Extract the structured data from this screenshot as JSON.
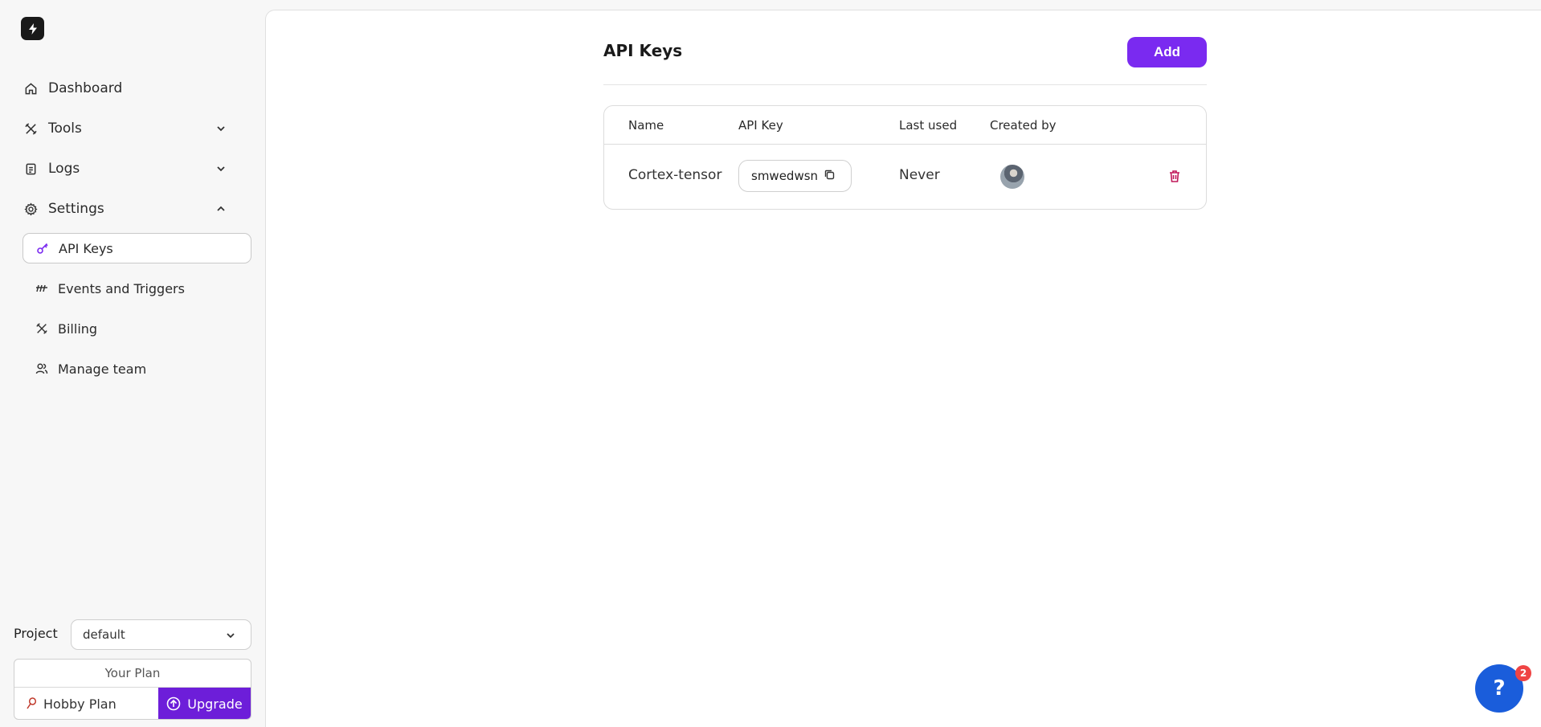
{
  "sidebar": {
    "logo_icon": "lightning-bolt-icon",
    "items": [
      {
        "label": "Dashboard",
        "icon": "home-icon"
      },
      {
        "label": "Tools",
        "icon": "tools-icon"
      },
      {
        "label": "Logs",
        "icon": "clipboard-icon"
      },
      {
        "label": "Settings",
        "icon": "gear-icon"
      }
    ],
    "settings_items": [
      {
        "label": "API Keys",
        "icon": "key-icon",
        "active": true
      },
      {
        "label": "Events and Triggers",
        "icon": "triggers-icon"
      },
      {
        "label": "Billing",
        "icon": "billing-icon"
      },
      {
        "label": "Manage team",
        "icon": "team-icon"
      }
    ],
    "project": {
      "label": "Project",
      "value": "default"
    },
    "plan": {
      "title": "Your Plan",
      "name": "Hobby Plan",
      "upgrade_label": "Upgrade"
    }
  },
  "main": {
    "title": "API Keys",
    "add_label": "Add",
    "table": {
      "headers": [
        "Name",
        "API Key",
        "Last used",
        "Created by"
      ],
      "rows": [
        {
          "name": "Cortex-tensor",
          "api_key": "smwedwsn",
          "last_used": "Never",
          "created_by": "user-avatar"
        }
      ]
    }
  },
  "help": {
    "label": "?",
    "badge": "2"
  },
  "colors": {
    "accent": "#7a2af0",
    "upgrade": "#6d1ed9",
    "help": "#1a5ddb",
    "danger": "#c0185a"
  }
}
